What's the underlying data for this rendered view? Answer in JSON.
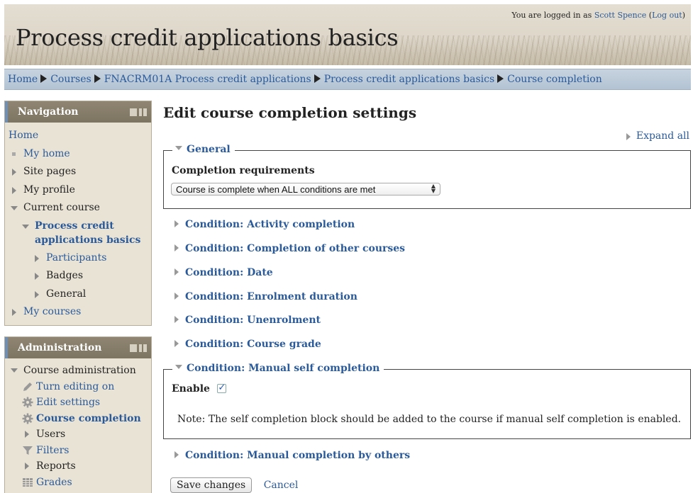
{
  "header": {
    "title": "Process credit applications basics",
    "login_prefix": "You are logged in as",
    "user": "Scott Spence",
    "logout": "Log out"
  },
  "breadcrumb": [
    "Home",
    "Courses",
    "FNACRM01A Process credit applications",
    "Process credit applications basics",
    "Course completion"
  ],
  "navigation": {
    "title": "Navigation",
    "home": "Home",
    "my_home": "My home",
    "site_pages": "Site pages",
    "my_profile": "My profile",
    "current_course": "Current course",
    "course_line1": "Process credit",
    "course_line2": "applications basics",
    "participants": "Participants",
    "badges": "Badges",
    "general": "General",
    "my_courses": "My courses"
  },
  "administration": {
    "title": "Administration",
    "course_admin": "Course administration",
    "turn_editing": "Turn editing on",
    "edit_settings": "Edit settings",
    "course_completion": "Course completion",
    "users": "Users",
    "filters": "Filters",
    "reports": "Reports",
    "grades": "Grades"
  },
  "main": {
    "heading": "Edit course completion settings",
    "expand_all": "Expand all",
    "general_legend": "General",
    "completion_req_label": "Completion requirements",
    "completion_req_value": "Course is complete when ALL conditions are met",
    "conditions": [
      "Condition: Activity completion",
      "Condition: Completion of other courses",
      "Condition: Date",
      "Condition: Enrolment duration",
      "Condition: Unenrolment",
      "Condition: Course grade"
    ],
    "manual_self_legend": "Condition: Manual self completion",
    "enable_label": "Enable",
    "enable_checked": true,
    "note": "Note: The self completion block should be added to the course if manual self completion is enabled.",
    "manual_others": "Condition: Manual completion by others",
    "save_button": "Save changes",
    "cancel_button": "Cancel"
  }
}
